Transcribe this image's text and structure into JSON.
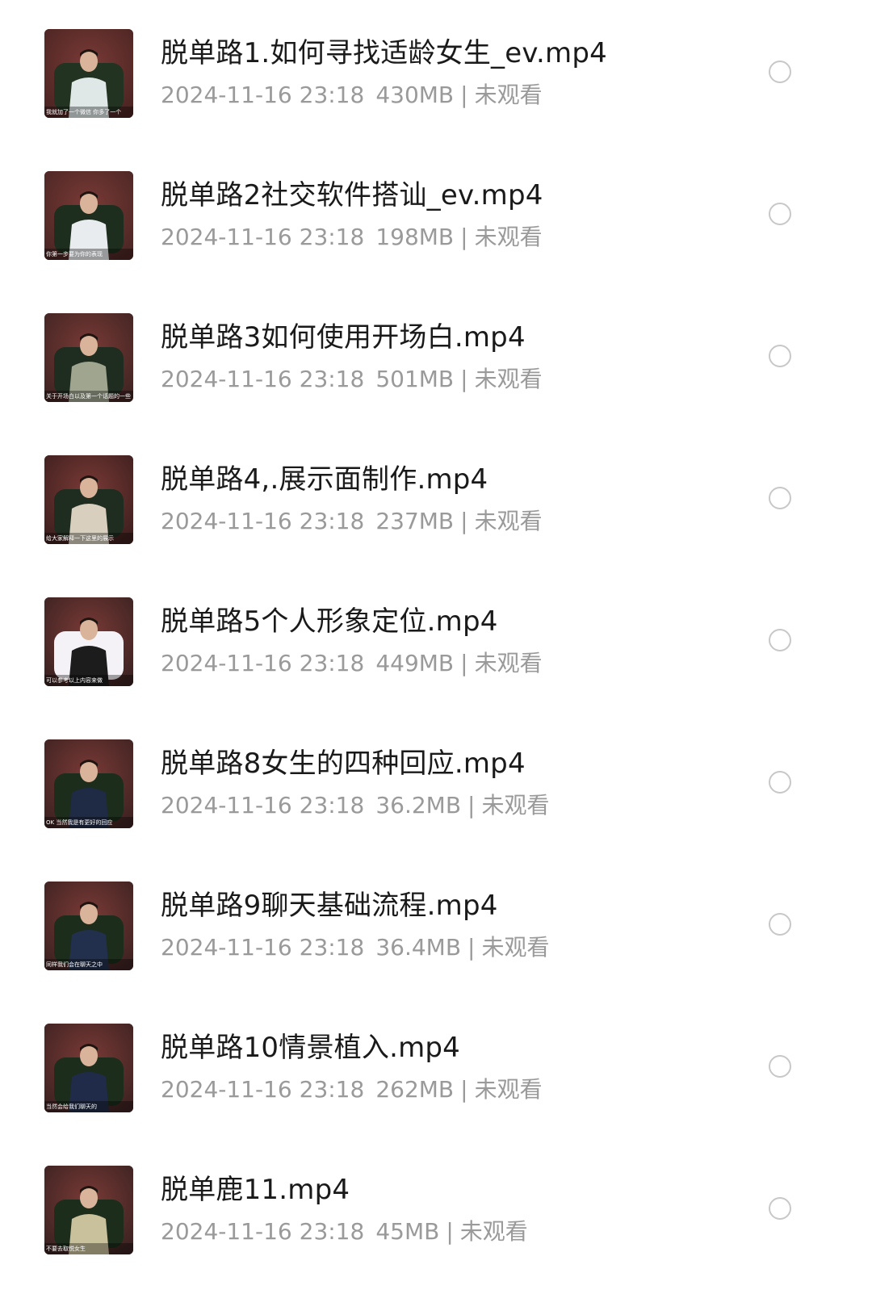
{
  "files": [
    {
      "title": "脱单路1.如何寻找适龄女生_ev.mp4",
      "date": "2024-11-16 23:18",
      "size": "430MB",
      "status": "未观看",
      "thumb_caption": "我就加了一个微信 你多了一个"
    },
    {
      "title": "脱单路2社交软件搭讪_ev.mp4",
      "date": "2024-11-16 23:18",
      "size": "198MB",
      "status": "未观看",
      "thumb_caption": "你第一步要为你的表现"
    },
    {
      "title": "脱单路3如何使用开场白.mp4",
      "date": "2024-11-16 23:18",
      "size": "501MB",
      "status": "未观看",
      "thumb_caption": "关于开场白以及第一个话题的一些"
    },
    {
      "title": "脱单路4,.展示面制作.mp4",
      "date": "2024-11-16 23:18",
      "size": "237MB",
      "status": "未观看",
      "thumb_caption": "给大家解释一下这里的展示"
    },
    {
      "title": "脱单路5个人形象定位.mp4",
      "date": "2024-11-16 23:18",
      "size": "449MB",
      "status": "未观看",
      "thumb_caption": "可以参考以上内容来做"
    },
    {
      "title": "脱单路8女生的四种回应.mp4",
      "date": "2024-11-16 23:18",
      "size": "36.2MB",
      "status": "未观看",
      "thumb_caption": "OK 当然我是有更好的回应"
    },
    {
      "title": "脱单路9聊天基础流程.mp4",
      "date": "2024-11-16 23:18",
      "size": "36.4MB",
      "status": "未观看",
      "thumb_caption": "同样我们会在聊天之中"
    },
    {
      "title": "脱单路10情景植入.mp4",
      "date": "2024-11-16 23:18",
      "size": "262MB",
      "status": "未观看",
      "thumb_caption": "当然会给我们聊天的"
    },
    {
      "title": "脱单鹿11.mp4",
      "date": "2024-11-16 23:18",
      "size": "45MB",
      "status": "未观看",
      "thumb_caption": "不要去取悦女生"
    }
  ],
  "thumb_palettes": [
    {
      "bg": "#4a2422",
      "suit": "#dfe8e6",
      "chair": "#223322"
    },
    {
      "bg": "#4a2624",
      "suit": "#e9ecef",
      "chair": "#1e2e1e"
    },
    {
      "bg": "#3f2422",
      "suit": "#9fa58f",
      "chair": "#1f2c20"
    },
    {
      "bg": "#3d1f1e",
      "suit": "#d8cfbf",
      "chair": "#1f2c20"
    },
    {
      "bg": "#3a2221",
      "suit": "#1c1c1c",
      "chair": "#f4f2f6"
    },
    {
      "bg": "#3d2221",
      "suit": "#1f2a44",
      "chair": "#1d2d1c"
    },
    {
      "bg": "#3d2221",
      "suit": "#22304d",
      "chair": "#1d2d1c"
    },
    {
      "bg": "#3d2221",
      "suit": "#1f2b48",
      "chair": "#1d2d1c"
    },
    {
      "bg": "#3a2221",
      "suit": "#c9c09c",
      "chair": "#1d2d1c"
    }
  ]
}
